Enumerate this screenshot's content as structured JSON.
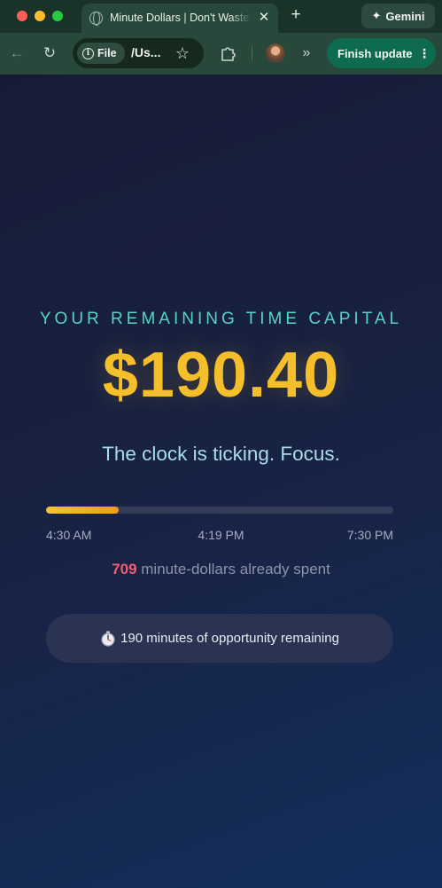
{
  "browser": {
    "tab": {
      "title": "Minute Dollars | Don't Waste Time",
      "close": "✕"
    },
    "new_tab": "+",
    "gemini": {
      "icon": "✦",
      "label": "Gemini"
    },
    "toolbar": {
      "back": "←",
      "reload": "↻",
      "chip_label": "File",
      "url": "/Us...",
      "star": "☆",
      "more_tabs": "»",
      "finish_update": "Finish update",
      "menu": "⋮"
    }
  },
  "page": {
    "eyebrow": "YOUR REMAINING TIME CAPITAL",
    "amount": "$190.40",
    "tagline": "The clock is ticking. Focus.",
    "progress": {
      "fraction": 0.21,
      "start": "4:30 AM",
      "now": "4:19 PM",
      "end": "7:30 PM"
    },
    "spent": {
      "number": "709",
      "text": "minute-dollars already spent"
    },
    "remaining": "190 minutes of opportunity remaining"
  },
  "colors": {
    "accent_teal": "#56d4c4",
    "amount_gold": "#f5bf2c",
    "spent_red": "#f05f72",
    "update_button": "#0f6b4f"
  }
}
